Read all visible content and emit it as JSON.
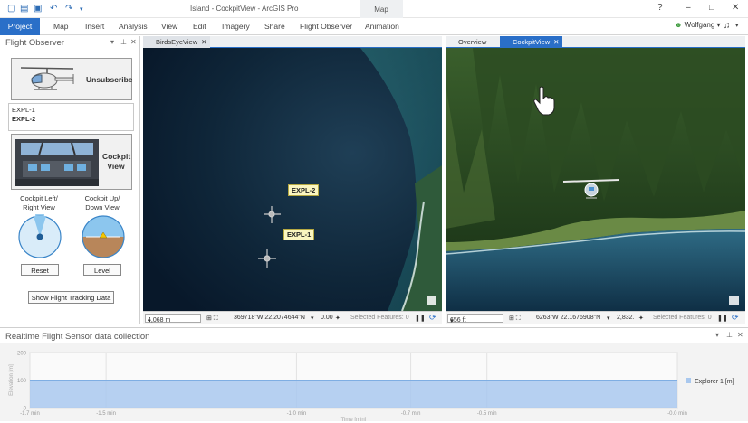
{
  "window": {
    "title": "Island - CockpitView - ArcGIS Pro",
    "context_tab_header": "Map",
    "help": "?",
    "minimize": "–",
    "maximize": "□",
    "close": "✕"
  },
  "ribbon": {
    "tabs": [
      "Project",
      "Map",
      "Insert",
      "Analysis",
      "View",
      "Edit",
      "Imagery",
      "Share",
      "Flight Observer",
      "Animation"
    ],
    "user": "Wolfgang",
    "user_caret": "▾"
  },
  "flight_observer": {
    "title": "Flight Observer",
    "unsubscribe_label": "Unsubscribe",
    "flights": [
      "EXPL-1",
      "EXPL-2"
    ],
    "selected_flight": "EXPL-2",
    "cockpit_view_line1": "Cockpit",
    "cockpit_view_line2": "View",
    "left_right_line1": "Cockpit Left/",
    "left_right_line2": "Right View",
    "up_down_line1": "Cockpit Up/",
    "up_down_line2": "Down View",
    "reset_label": "Reset",
    "level_label": "Level",
    "tracking_label": "Show Flight Tracking Data"
  },
  "birds_eye": {
    "tab_label": "BirdsEyeView",
    "tab_close": "✕",
    "callout_1": "EXPL-2",
    "callout_2": "EXPL-1",
    "scale": "4,068 m",
    "scale_caret": "▾",
    "coords": "369718\"W 22.2074644\"N",
    "coord_caret": "▾",
    "rotation": "0.00",
    "selected_features": "Selected Features: 0",
    "pause": "❚❚",
    "refresh": "⟳"
  },
  "cockpit": {
    "overview_tab": "Overview",
    "tab_label": "CockpitView",
    "tab_close": "✕",
    "scale": "656 ft",
    "scale_caret": "▾",
    "coords": "6263\"W 22.1676908\"N",
    "coord_caret": "▾",
    "rotation": "2,832.",
    "selected_features": "Selected Features: 0",
    "pause": "❚❚",
    "refresh": "⟳"
  },
  "sensor_panel": {
    "title": "Realtime Flight Sensor data collection"
  },
  "chart_data": {
    "type": "area",
    "ylabel": "Elevation [m]",
    "xlabel": "Time [min]",
    "yticks": [
      "200",
      "100",
      "0"
    ],
    "ylim": [
      0,
      200
    ],
    "xticks": [
      "-1.7 min",
      "-1.5 min",
      "-1.0 min",
      "-0.7 min",
      "-0.5 min",
      "-0.0 min"
    ],
    "series": [
      {
        "name": "Explorer 1 [m]",
        "x": [
          -1.7,
          -0.0
        ],
        "values": [
          100,
          100
        ],
        "color": "#a9c8ee"
      }
    ],
    "grid": true,
    "legend": "right"
  },
  "colors": {
    "accent": "#2a6fc8",
    "series": "#a9c8ee"
  }
}
